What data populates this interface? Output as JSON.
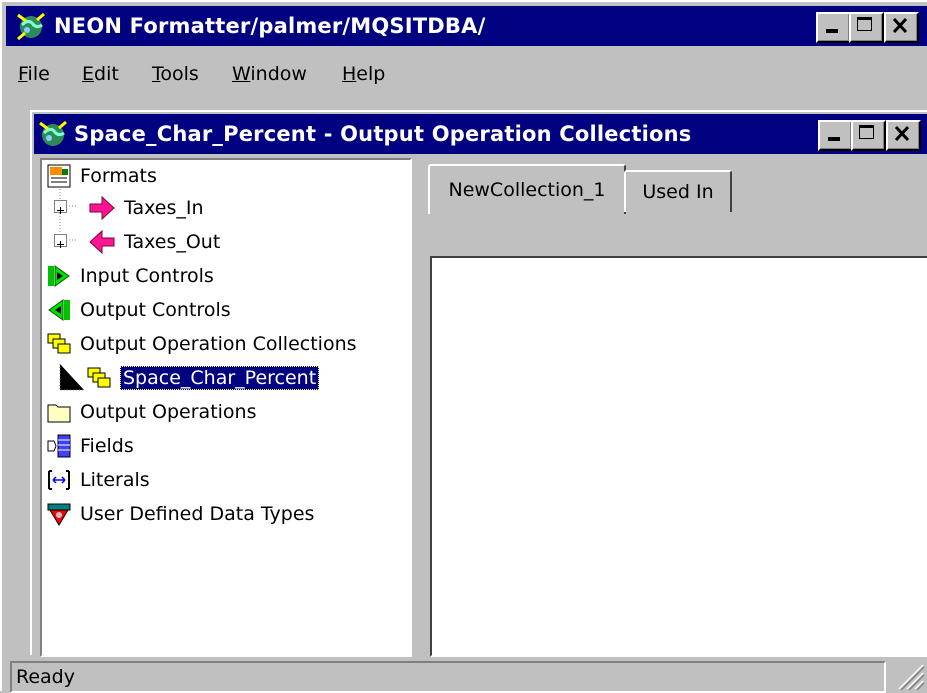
{
  "app": {
    "title": "NEON Formatter/palmer/MQSITDBA/",
    "icon": "neon-globe-icon"
  },
  "menu": {
    "items": [
      {
        "label": "File"
      },
      {
        "label": "Edit"
      },
      {
        "label": "Tools"
      },
      {
        "label": "Window"
      },
      {
        "label": "Help"
      }
    ]
  },
  "child_window": {
    "title": "Space_Char_Percent - Output Operation Collections",
    "icon": "neon-globe-icon"
  },
  "tree": {
    "items": [
      {
        "label": "Formats",
        "icon": "formats-icon"
      },
      {
        "label": "Taxes_In",
        "icon": "arrow-right-pink-icon"
      },
      {
        "label": "Taxes_Out",
        "icon": "arrow-left-pink-icon"
      },
      {
        "label": "Input Controls",
        "icon": "input-controls-icon"
      },
      {
        "label": "Output Controls",
        "icon": "output-controls-icon"
      },
      {
        "label": "Output Operation Collections",
        "icon": "collection-icon"
      },
      {
        "label": "Space_Char_Percent",
        "icon": "collection-icon",
        "selected": true
      },
      {
        "label": "Output Operations",
        "icon": "folder-icon"
      },
      {
        "label": "Fields",
        "icon": "fields-icon"
      },
      {
        "label": "Literals",
        "icon": "literals-icon"
      },
      {
        "label": "User Defined Data Types",
        "icon": "user-defined-types-icon"
      }
    ]
  },
  "tabs": [
    {
      "label": "NewCollection_1",
      "active": true
    },
    {
      "label": "Used In",
      "active": false
    }
  ],
  "status": {
    "text": "Ready"
  },
  "colors": {
    "titlebar": "#000080",
    "face": "#c0c0c0",
    "selection": "#000080"
  }
}
